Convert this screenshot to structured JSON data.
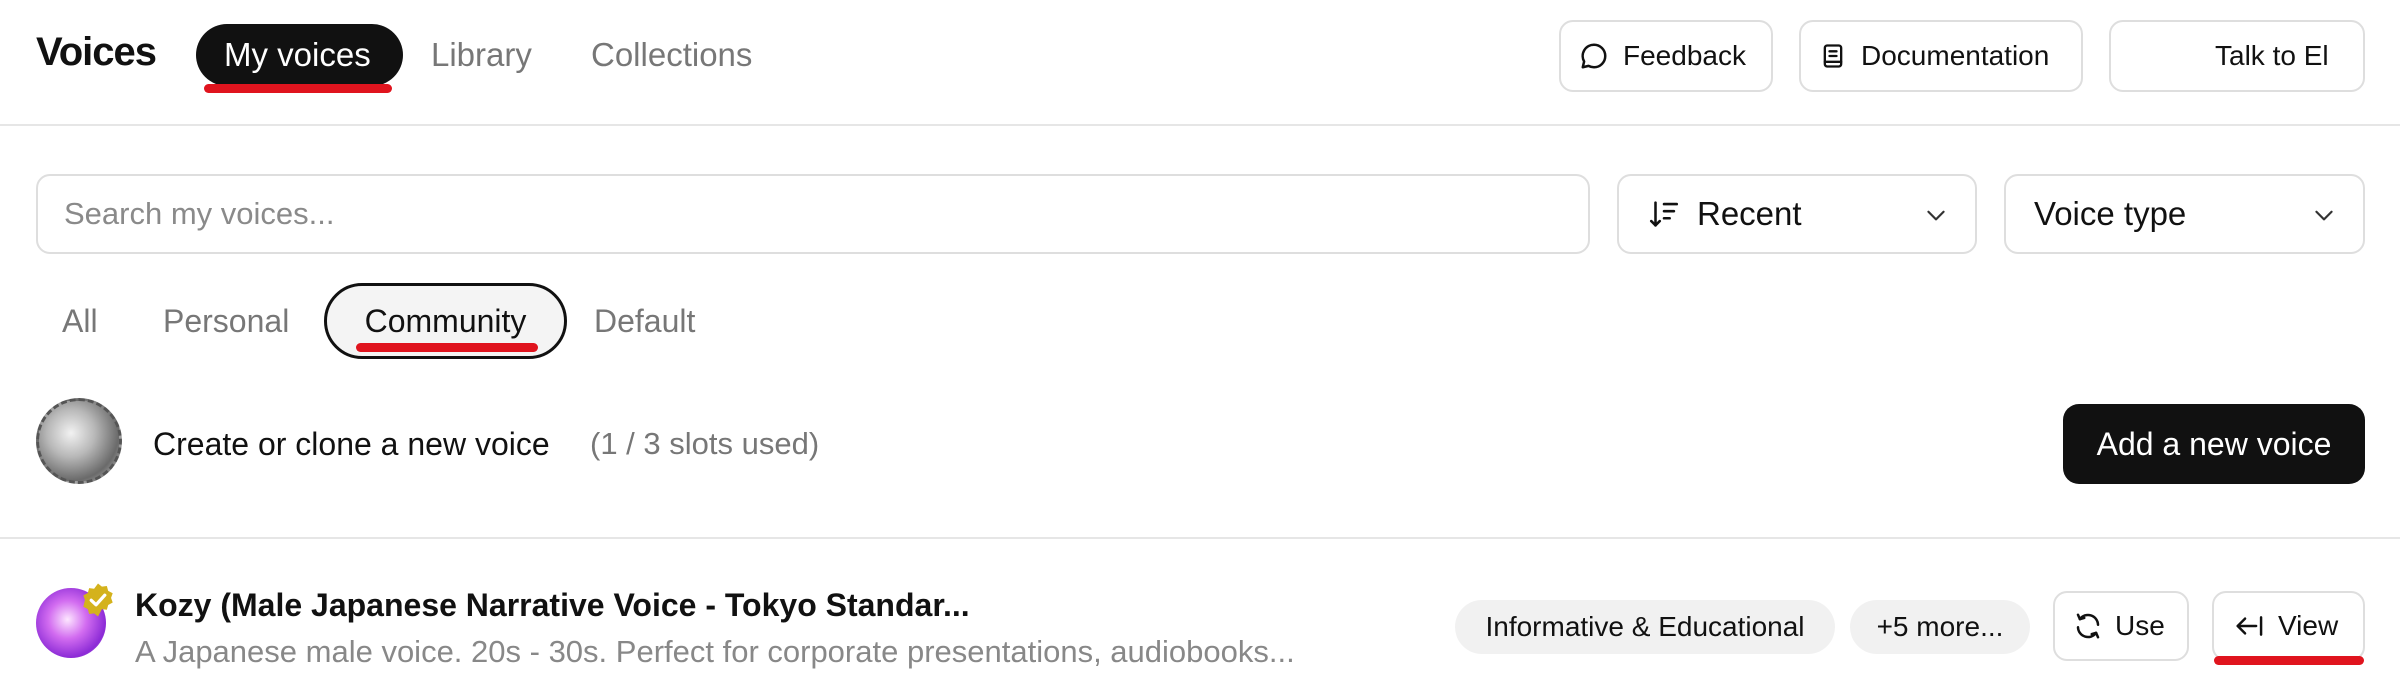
{
  "header": {
    "title": "Voices",
    "tabs": [
      {
        "label": "My voices",
        "active": true
      },
      {
        "label": "Library",
        "active": false
      },
      {
        "label": "Collections",
        "active": false
      }
    ],
    "buttons": {
      "feedback": "Feedback",
      "documentation": "Documentation",
      "talk": "Talk to El"
    }
  },
  "search": {
    "placeholder": "Search my voices...",
    "value": ""
  },
  "filters": {
    "sort": "Recent",
    "voice_type": "Voice type"
  },
  "sub_tabs": [
    {
      "label": "All",
      "active": false
    },
    {
      "label": "Personal",
      "active": false
    },
    {
      "label": "Community",
      "active": true
    },
    {
      "label": "Default",
      "active": false
    }
  ],
  "create": {
    "label": "Create or clone a new voice",
    "slots": "(1 / 3 slots used)",
    "button": "Add a new voice"
  },
  "voices": [
    {
      "name": "Kozy (Male Japanese Narrative Voice - Tokyo Standar...",
      "description": "A Japanese male voice. 20s - 30s. Perfect for corporate presentations, audiobooks...",
      "tags": [
        "Informative & Educational",
        "+5 more..."
      ],
      "use_label": "Use",
      "view_label": "View",
      "verified": true
    }
  ],
  "colors": {
    "accent": "#111111",
    "annotation": "#e0141e",
    "verified_badge": "#d4b21c"
  }
}
